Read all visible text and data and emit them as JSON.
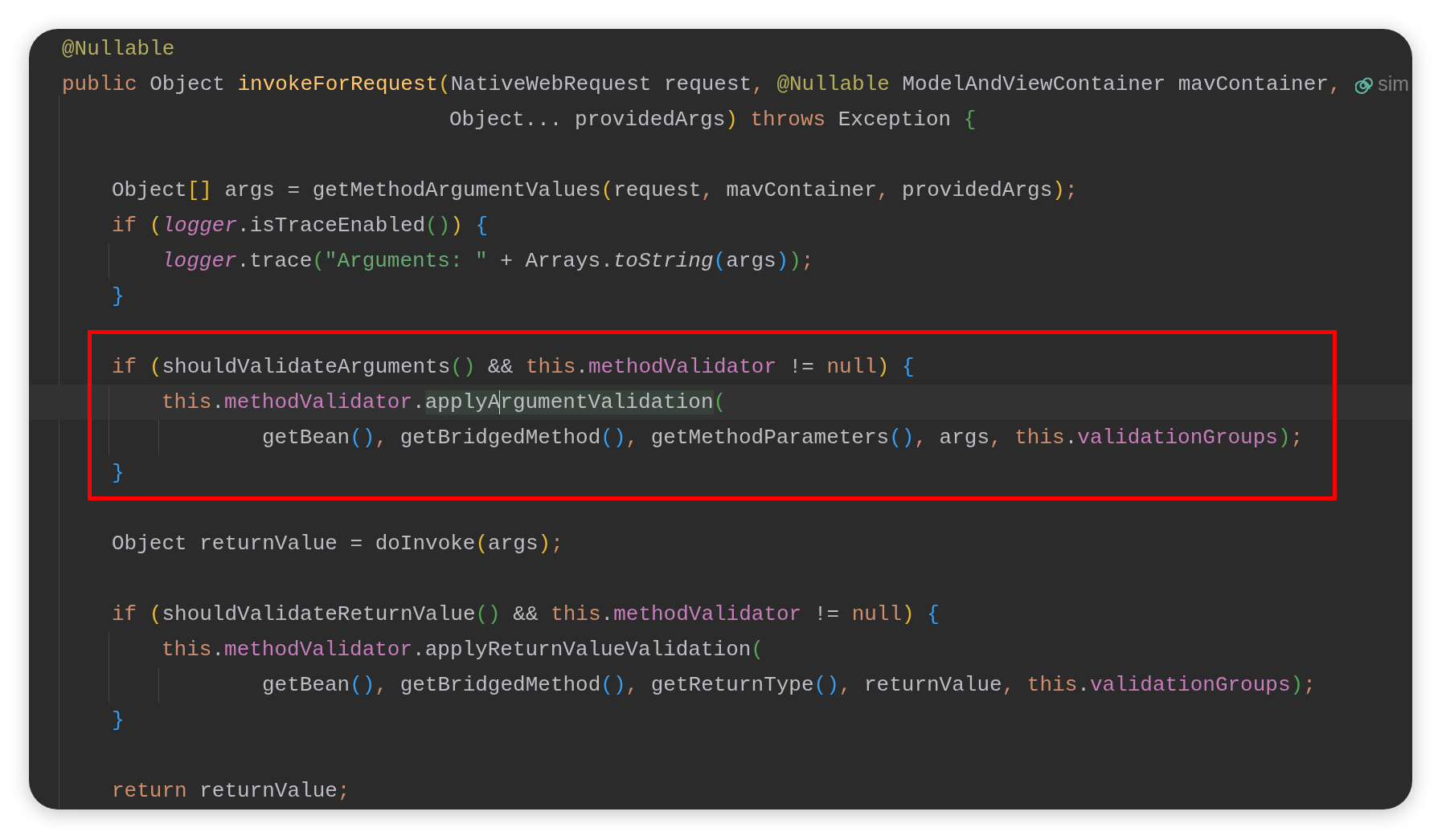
{
  "lines": [
    {
      "kind": "top",
      "tokens": [
        {
          "kind": "ann",
          "t": "@Nullable"
        }
      ]
    },
    {
      "kind": "top",
      "tokens": [
        {
          "kind": "kw",
          "t": "public"
        },
        {
          "kind": "plain",
          "t": " Object "
        },
        {
          "kind": "fn",
          "t": "invokeForRequest"
        },
        {
          "kind": "b1",
          "t": "("
        },
        {
          "kind": "plain",
          "t": "NativeWebRequest request"
        },
        {
          "kind": "punct",
          "t": ", "
        },
        {
          "kind": "ann",
          "t": "@Nullable"
        },
        {
          "kind": "plain",
          "t": " ModelAndViewContainer mavContainer"
        },
        {
          "kind": "punct",
          "t": ", "
        }
      ],
      "hint": "sim"
    },
    {
      "kind": "continuation",
      "tokens": [
        {
          "kind": "plain",
          "t": "Object... providedArgs"
        },
        {
          "kind": "b1",
          "t": ")"
        },
        {
          "kind": "kw",
          "t": " throws"
        },
        {
          "kind": "plain",
          "t": " Exception "
        },
        {
          "kind": "b2",
          "t": "{"
        }
      ]
    },
    {
      "kind": "blank"
    },
    {
      "kind": "body",
      "tokens": [
        {
          "kind": "plain",
          "t": "Object"
        },
        {
          "kind": "b1",
          "t": "[]"
        },
        {
          "kind": "plain",
          "t": " args = getMethodArgumentValues"
        },
        {
          "kind": "b1",
          "t": "("
        },
        {
          "kind": "plain",
          "t": "request"
        },
        {
          "kind": "punct",
          "t": ","
        },
        {
          "kind": "plain",
          "t": " mavContainer"
        },
        {
          "kind": "punct",
          "t": ","
        },
        {
          "kind": "plain",
          "t": " providedArgs"
        },
        {
          "kind": "b1",
          "t": ")"
        },
        {
          "kind": "punct",
          "t": ";"
        }
      ]
    },
    {
      "kind": "body",
      "tokens": [
        {
          "kind": "kw",
          "t": "if"
        },
        {
          "kind": "b1",
          "t": " ("
        },
        {
          "kind": "sfield",
          "t": "logger"
        },
        {
          "kind": "plain",
          "t": ".isTraceEnabled"
        },
        {
          "kind": "b2",
          "t": "()"
        },
        {
          "kind": "b1",
          "t": ")"
        },
        {
          "kind": "b3",
          "t": " {"
        }
      ]
    },
    {
      "kind": "nested",
      "tokens": [
        {
          "kind": "sfield",
          "t": "logger"
        },
        {
          "kind": "plain",
          "t": ".trace"
        },
        {
          "kind": "b2",
          "t": "("
        },
        {
          "kind": "str",
          "t": "\"Arguments: \""
        },
        {
          "kind": "plain",
          "t": " + Arrays."
        },
        {
          "kind": "scall",
          "t": "toString"
        },
        {
          "kind": "b3",
          "t": "("
        },
        {
          "kind": "plain",
          "t": "args"
        },
        {
          "kind": "b3",
          "t": ")"
        },
        {
          "kind": "b2",
          "t": ")"
        },
        {
          "kind": "punct",
          "t": ";"
        }
      ]
    },
    {
      "kind": "body",
      "tokens": [
        {
          "kind": "b3",
          "t": "}"
        }
      ]
    },
    {
      "kind": "blank"
    },
    {
      "kind": "boxed",
      "lines": [
        {
          "kind": "body",
          "tokens": [
            {
              "kind": "kw",
              "t": "if"
            },
            {
              "kind": "b1",
              "t": " ("
            },
            {
              "kind": "plain",
              "t": "shouldValidateArguments"
            },
            {
              "kind": "b2",
              "t": "()"
            },
            {
              "kind": "plain",
              "t": " && "
            },
            {
              "kind": "kw",
              "t": "this"
            },
            {
              "kind": "plain",
              "t": "."
            },
            {
              "kind": "field",
              "t": "methodValidator"
            },
            {
              "kind": "plain",
              "t": " != "
            },
            {
              "kind": "kw",
              "t": "null"
            },
            {
              "kind": "b1",
              "t": ")"
            },
            {
              "kind": "b3",
              "t": " {"
            }
          ]
        },
        {
          "kind": "current",
          "tokens": [
            {
              "kind": "kw",
              "t": "this"
            },
            {
              "kind": "plain",
              "t": "."
            },
            {
              "kind": "field",
              "t": "methodValidator"
            },
            {
              "kind": "plain",
              "t": "."
            },
            {
              "kind": "usage",
              "t": "applyA"
            },
            {
              "kind": "caret"
            },
            {
              "kind": "usage",
              "t": "rgumentValidation"
            },
            {
              "kind": "b2",
              "t": "("
            }
          ]
        },
        {
          "kind": "wrapped",
          "tokens": [
            {
              "kind": "plain",
              "t": "getBean"
            },
            {
              "kind": "b3",
              "t": "()"
            },
            {
              "kind": "punct",
              "t": ","
            },
            {
              "kind": "plain",
              "t": " getBridgedMethod"
            },
            {
              "kind": "b3",
              "t": "()"
            },
            {
              "kind": "punct",
              "t": ","
            },
            {
              "kind": "plain",
              "t": " getMethodParameters"
            },
            {
              "kind": "b3",
              "t": "()"
            },
            {
              "kind": "punct",
              "t": ","
            },
            {
              "kind": "plain",
              "t": " args"
            },
            {
              "kind": "punct",
              "t": ", "
            },
            {
              "kind": "kw",
              "t": "this"
            },
            {
              "kind": "plain",
              "t": "."
            },
            {
              "kind": "field",
              "t": "validationGroups"
            },
            {
              "kind": "b2",
              "t": ")"
            },
            {
              "kind": "punct",
              "t": ";"
            }
          ]
        },
        {
          "kind": "body",
          "tokens": [
            {
              "kind": "b3",
              "t": "}"
            }
          ]
        }
      ]
    },
    {
      "kind": "blank"
    },
    {
      "kind": "body",
      "tokens": [
        {
          "kind": "plain",
          "t": "Object returnValue = doInvoke"
        },
        {
          "kind": "b1",
          "t": "("
        },
        {
          "kind": "plain",
          "t": "args"
        },
        {
          "kind": "b1",
          "t": ")"
        },
        {
          "kind": "punct",
          "t": ";"
        }
      ]
    },
    {
      "kind": "blank"
    },
    {
      "kind": "body",
      "tokens": [
        {
          "kind": "kw",
          "t": "if"
        },
        {
          "kind": "b1",
          "t": " ("
        },
        {
          "kind": "plain",
          "t": "shouldValidateReturnValue"
        },
        {
          "kind": "b2",
          "t": "()"
        },
        {
          "kind": "plain",
          "t": " && "
        },
        {
          "kind": "kw",
          "t": "this"
        },
        {
          "kind": "plain",
          "t": "."
        },
        {
          "kind": "field",
          "t": "methodValidator"
        },
        {
          "kind": "plain",
          "t": " != "
        },
        {
          "kind": "kw",
          "t": "null"
        },
        {
          "kind": "b1",
          "t": ")"
        },
        {
          "kind": "b3",
          "t": " {"
        }
      ]
    },
    {
      "kind": "nested",
      "tokens": [
        {
          "kind": "kw",
          "t": "this"
        },
        {
          "kind": "plain",
          "t": "."
        },
        {
          "kind": "field",
          "t": "methodValidator"
        },
        {
          "kind": "plain",
          "t": ".applyReturnValueValidation"
        },
        {
          "kind": "b2",
          "t": "("
        }
      ]
    },
    {
      "kind": "wrapped",
      "tokens": [
        {
          "kind": "plain",
          "t": "getBean"
        },
        {
          "kind": "b3",
          "t": "()"
        },
        {
          "kind": "punct",
          "t": ","
        },
        {
          "kind": "plain",
          "t": " getBridgedMethod"
        },
        {
          "kind": "b3",
          "t": "()"
        },
        {
          "kind": "punct",
          "t": ","
        },
        {
          "kind": "plain",
          "t": " getReturnType"
        },
        {
          "kind": "b3",
          "t": "()"
        },
        {
          "kind": "punct",
          "t": ","
        },
        {
          "kind": "plain",
          "t": " returnValue"
        },
        {
          "kind": "punct",
          "t": ", "
        },
        {
          "kind": "kw",
          "t": "this"
        },
        {
          "kind": "plain",
          "t": "."
        },
        {
          "kind": "field",
          "t": "validationGroups"
        },
        {
          "kind": "b2",
          "t": ")"
        },
        {
          "kind": "punct",
          "t": ";"
        }
      ]
    },
    {
      "kind": "body",
      "tokens": [
        {
          "kind": "b3",
          "t": "}"
        }
      ]
    },
    {
      "kind": "blank"
    },
    {
      "kind": "body",
      "tokens": [
        {
          "kind": "kw",
          "t": "return"
        },
        {
          "kind": "plain",
          "t": " returnValue"
        },
        {
          "kind": "punct",
          "t": ";"
        }
      ]
    }
  ]
}
